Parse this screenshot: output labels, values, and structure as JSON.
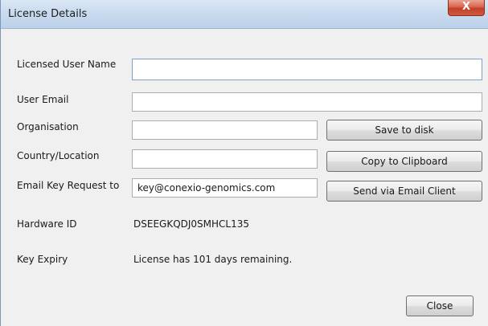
{
  "window": {
    "title": "License Details",
    "close_glyph": "X"
  },
  "form": {
    "user_name": {
      "label": "Licensed User Name",
      "value": ""
    },
    "user_email": {
      "label": "User Email",
      "value": ""
    },
    "organisation": {
      "label": "Organisation",
      "value": ""
    },
    "country": {
      "label": "Country/Location",
      "value": ""
    },
    "email_key_request": {
      "label": "Email Key Request to",
      "value": "key@conexio-genomics.com"
    },
    "hardware_id": {
      "label": "Hardware ID",
      "value": "DSEEGKQDJ0SMHCL135"
    },
    "key_expiry": {
      "label": "Key Expiry",
      "value": "License has 101 days remaining."
    }
  },
  "buttons": {
    "save_to_disk": "Save to disk",
    "copy_to_clipboard": "Copy to Clipboard",
    "send_via_email": "Send via Email Client",
    "close": "Close"
  }
}
